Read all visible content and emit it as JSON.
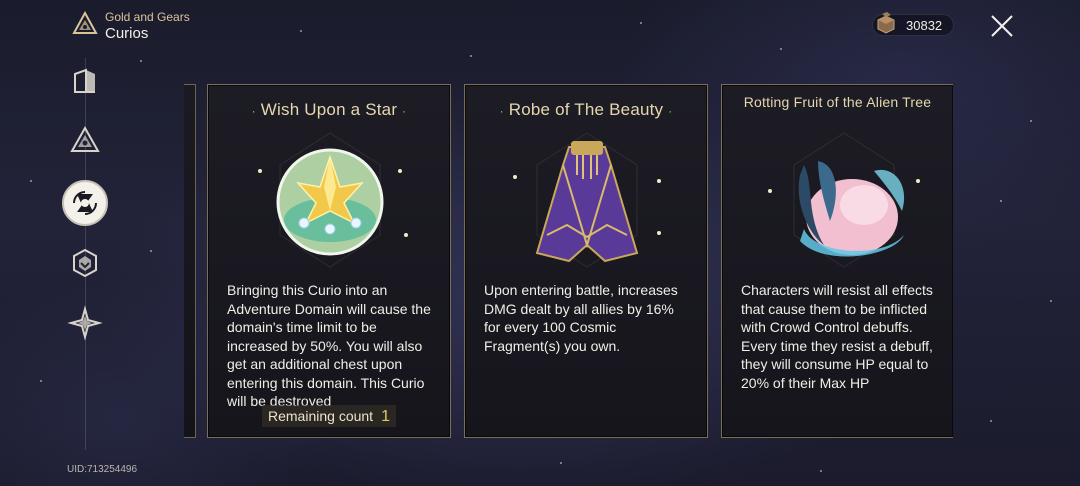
{
  "header": {
    "subtitle": "Gold and Gears",
    "title": "Curios"
  },
  "currency": {
    "value": "30832",
    "icon": "fragment-cube-icon"
  },
  "sidebar": {
    "items": [
      {
        "icon": "door-icon",
        "active": false
      },
      {
        "icon": "triangle-emblem-icon",
        "active": false
      },
      {
        "icon": "curio-emblem-icon",
        "active": true
      },
      {
        "icon": "shield-emblem-icon",
        "active": false
      },
      {
        "icon": "star-emblem-icon",
        "active": false
      }
    ]
  },
  "uid": "UID:713254496",
  "cards": [
    {
      "title": "Wish Upon a Star",
      "art": "star-crystal-orb-icon",
      "description": "Bringing this Curio into an Adventure Domain will cause the domain's time limit to be increased by 50%. You will also get an additional chest upon entering this domain. This Curio will be destroyed",
      "remaining_label": "Remaining count",
      "remaining_value": "1"
    },
    {
      "title": "Robe of The Beauty",
      "art": "purple-robe-icon",
      "description": "Upon entering battle, increases DMG dealt by all allies by 16% for every 100 Cosmic Fragment(s) you own."
    },
    {
      "title": "Rotting Fruit of the Alien Tree",
      "art": "alien-fruit-icon",
      "description": "Characters will resist all effects that cause them to be inflicted with Crowd Control debuffs. Every time they resist a debuff, they will consume HP equal to 20% of their Max HP"
    }
  ],
  "colors": {
    "card_border": "#7a6f56",
    "title_gold": "#e6d6ad",
    "count_gold": "#e6c66a"
  }
}
